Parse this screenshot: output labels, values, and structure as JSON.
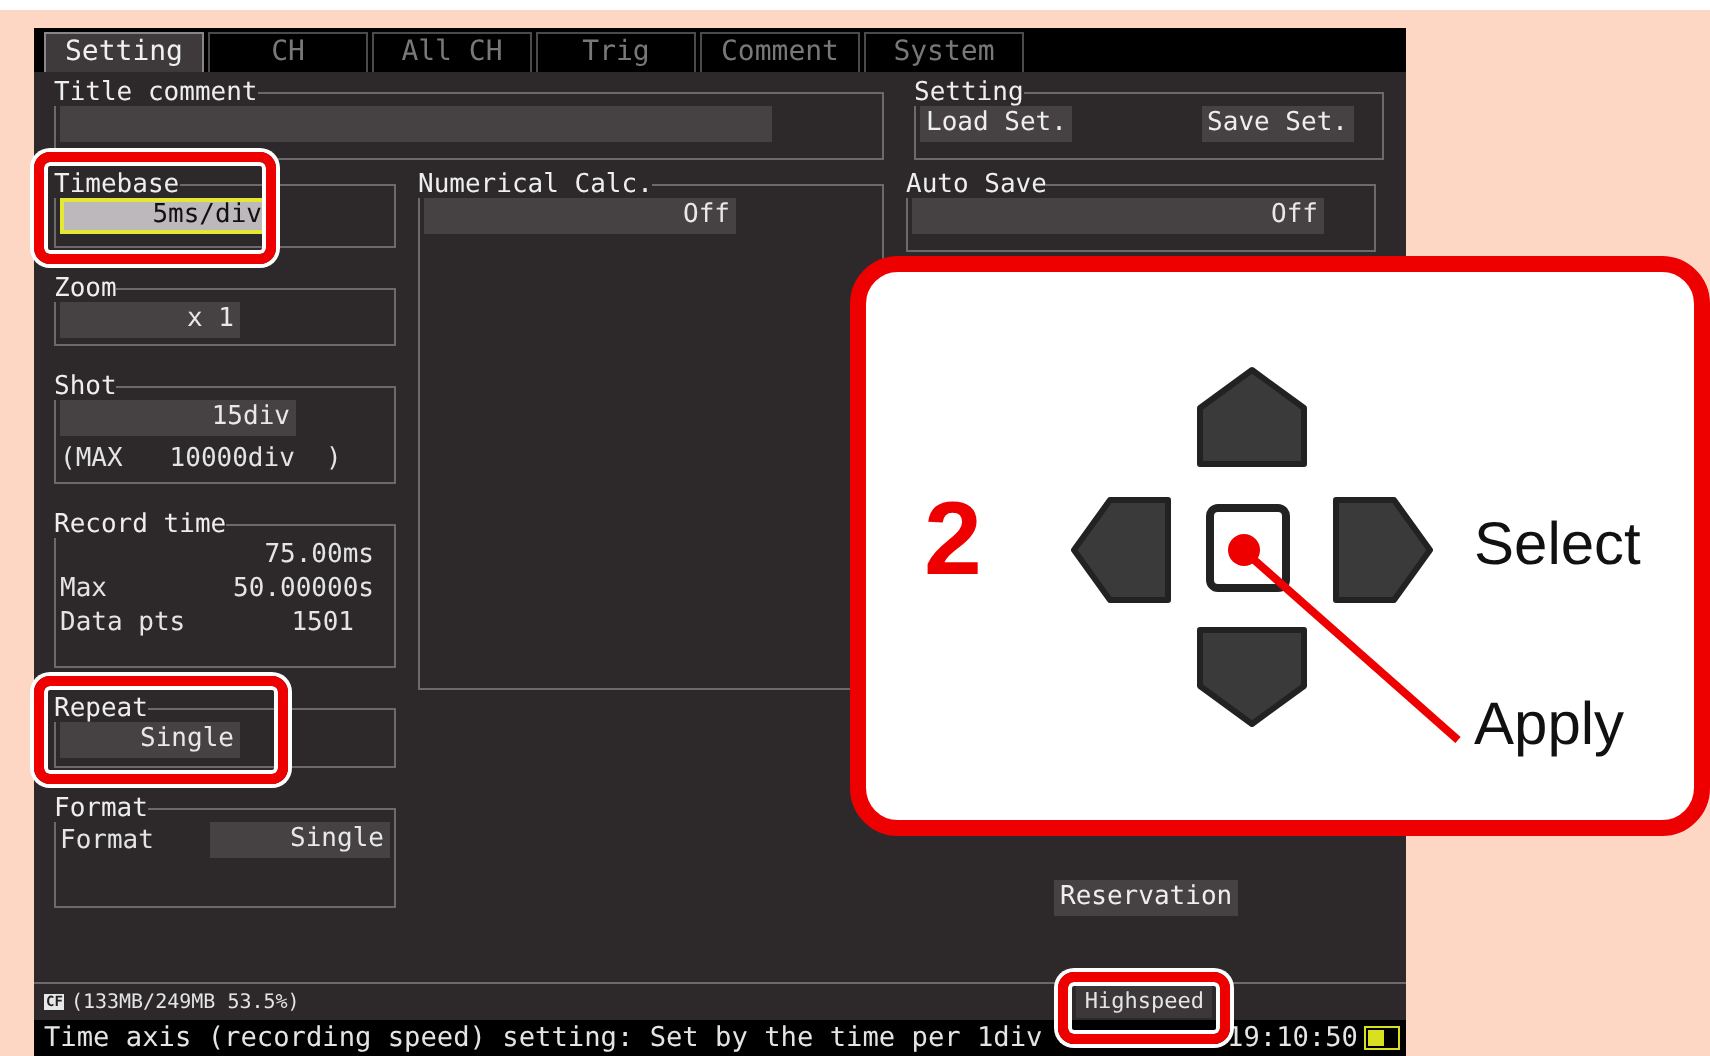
{
  "tabs": [
    {
      "label": "Setting",
      "selected": true
    },
    {
      "label": "CH",
      "selected": false
    },
    {
      "label": "All CH",
      "selected": false
    },
    {
      "label": "Trig",
      "selected": false
    },
    {
      "label": "Comment",
      "selected": false
    },
    {
      "label": "System",
      "selected": false
    }
  ],
  "title_comment": {
    "label": "Title comment"
  },
  "setting": {
    "label": "Setting",
    "buttons": [
      "Load Set.",
      "Save Set."
    ]
  },
  "timebase": {
    "label": "Timebase",
    "value": "5ms/div",
    "selected": true
  },
  "zoom": {
    "label": "Zoom",
    "value": "x 1",
    "selected": false
  },
  "shot": {
    "label": "Shot",
    "value": "15div",
    "max": "(MAX   10000div  )"
  },
  "record_time": {
    "label": "Record time",
    "value": "75.00ms",
    "rows": [
      {
        "label": "Max",
        "value": "50.00000s"
      },
      {
        "label": "Data pts",
        "value": "1501"
      }
    ]
  },
  "repeat": {
    "label": "Repeat",
    "value": "Single"
  },
  "format": {
    "label": "Format",
    "row_label": "Format",
    "value": "Single"
  },
  "numerical_calc": {
    "label": "Numerical Calc.",
    "value": "Off"
  },
  "auto_save": {
    "label": "Auto Save",
    "value": "Off"
  },
  "reservation": "Reservation",
  "storage": {
    "badge": "CF",
    "text": "(133MB/249MB 53.5%)"
  },
  "status": {
    "message": "Time axis (recording speed) setting: Set by the time per 1div",
    "mode": "Highspeed",
    "time": "19:10:50"
  },
  "callout": {
    "step": "2",
    "labels": [
      "Select",
      "Apply"
    ]
  }
}
